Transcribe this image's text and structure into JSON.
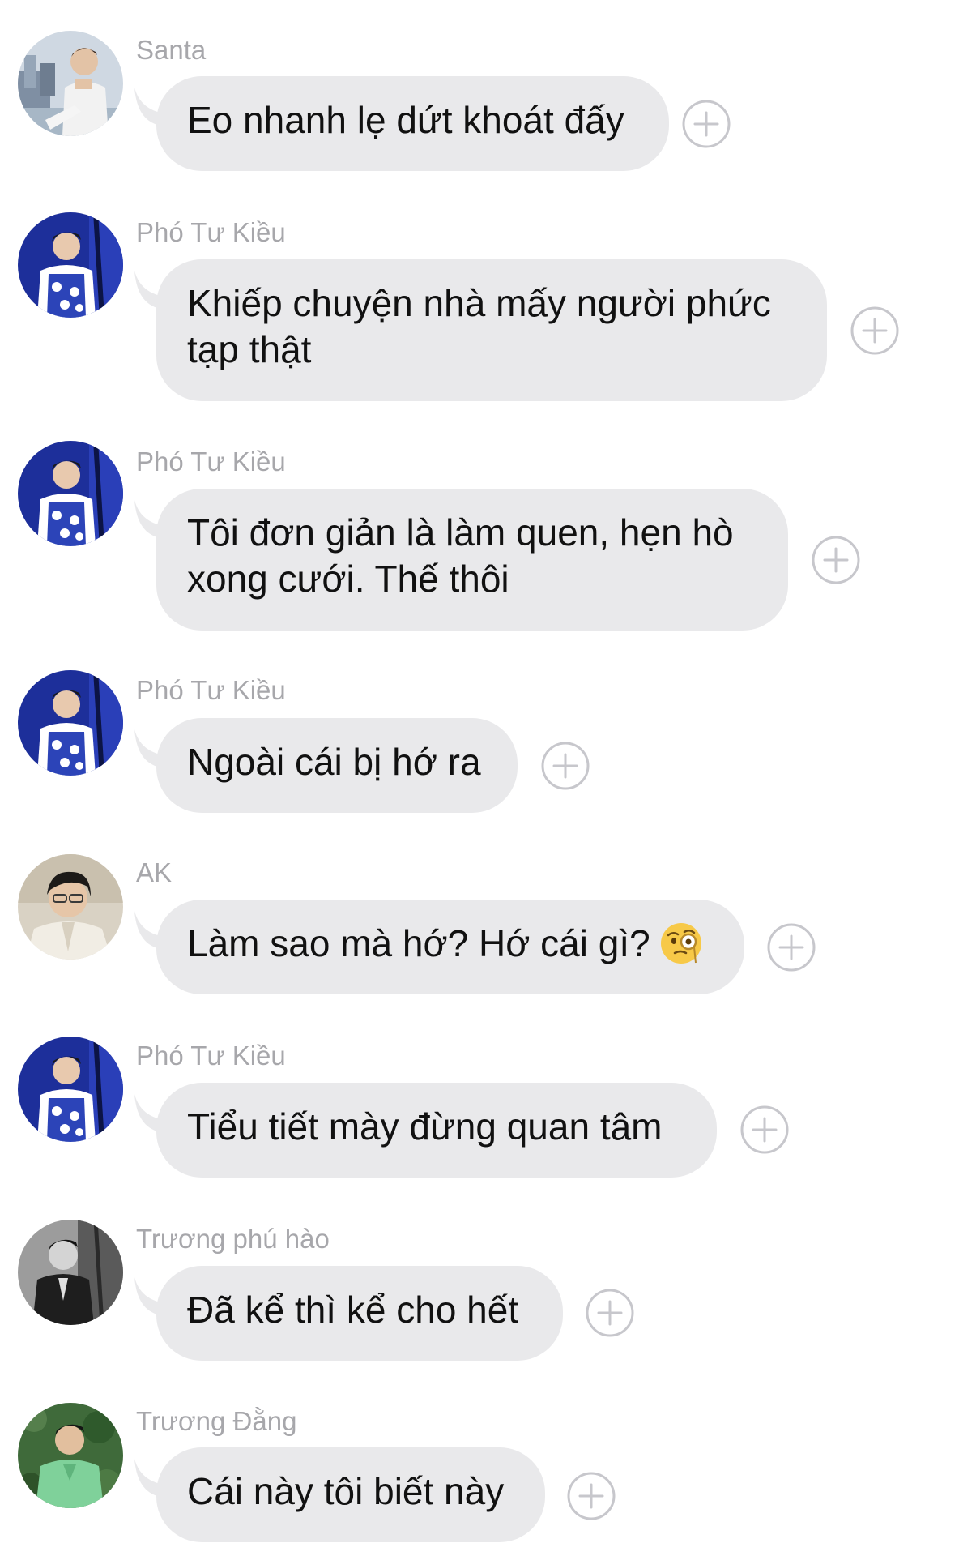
{
  "messages": [
    {
      "sender": "Santa",
      "text": "Eo nhanh lẹ dứt khoát đấy",
      "avatar": "avatar-santa"
    },
    {
      "sender": "Phó Tư Kiều",
      "text": "Khiếp chuyện nhà mấy người phức tạp thật",
      "avatar": "avatar-pho-tu-kieu"
    },
    {
      "sender": "Phó Tư Kiều",
      "text": "Tôi đơn giản là làm quen, hẹn hò xong cưới. Thế thôi",
      "avatar": "avatar-pho-tu-kieu"
    },
    {
      "sender": "Phó Tư Kiều",
      "text": "Ngoài cái bị hớ ra",
      "avatar": "avatar-pho-tu-kieu"
    },
    {
      "sender": "AK",
      "text": "Làm sao mà hớ? Hớ cái gì?",
      "emoji": "face-with-monocle-emoji",
      "avatar": "avatar-ak"
    },
    {
      "sender": "Phó Tư Kiều",
      "text": "Tiểu tiết mày đừng quan tâm",
      "avatar": "avatar-pho-tu-kieu"
    },
    {
      "sender": "Trương phú hào",
      "text": "Đã kể thì kể cho hết",
      "avatar": "avatar-truong-phu-hao"
    },
    {
      "sender": "Trương Đằng",
      "text": "Cái này tôi biết này",
      "avatar": "avatar-truong-dang"
    }
  ],
  "icons": {
    "reaction": "add-reaction-icon"
  },
  "colors": {
    "bubble": "#e9e9eb",
    "sender": "#a7a7ab",
    "text": "#111111",
    "reaction_outline": "#c7c7cc"
  }
}
